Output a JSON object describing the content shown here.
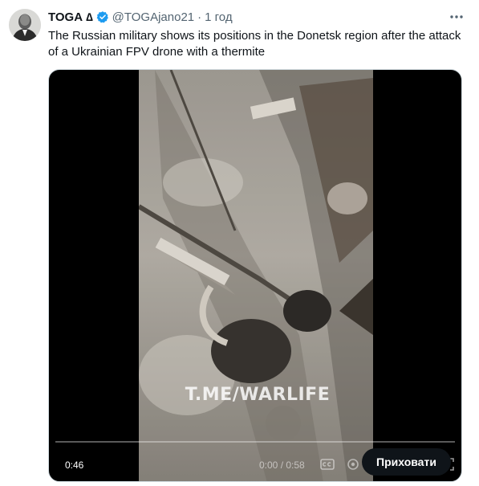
{
  "author": {
    "display_name": "TOGA",
    "name_glyph": "∆",
    "handle": "@TOGAjano21",
    "separator": "·",
    "time": "1 год"
  },
  "tweet": {
    "text": "The Russian military shows its positions in the Donetsk region after the attack of a Ukrainian FPV drone with a thermite"
  },
  "media": {
    "watermark": "T.ME/WARLIFE",
    "elapsed": "0:46",
    "duration": "0:00 / 0:58",
    "progress_fraction": 0.0,
    "hide_button_label": "Приховати",
    "icons": [
      "captions-icon",
      "settings-icon",
      "fullscreen-icon"
    ]
  },
  "colors": {
    "verified": "#1d9bf0",
    "text": "#0f1419",
    "secondary": "#536471",
    "button_bg": "#0f1419"
  }
}
